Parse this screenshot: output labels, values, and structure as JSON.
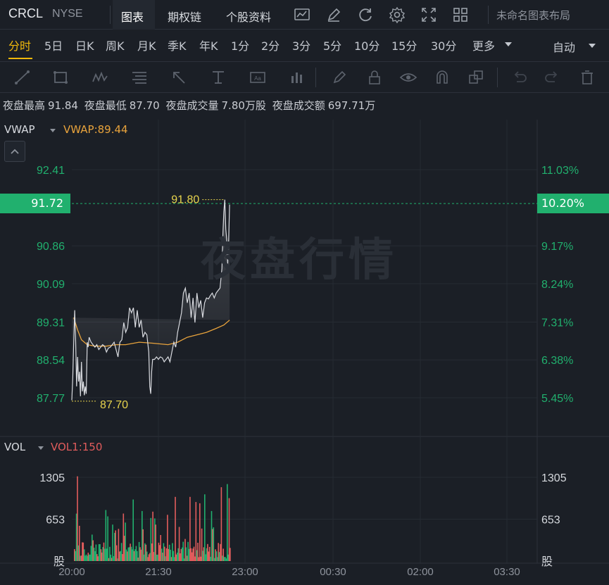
{
  "header": {
    "ticker": "CRCL",
    "exchange": "NYSE",
    "tabs": [
      "图表",
      "期权链",
      "个股资料"
    ],
    "active_tab": "图表",
    "layout_name": "未命名图表布局"
  },
  "periods": {
    "items": [
      "分时",
      "5日",
      "日K",
      "周K",
      "月K",
      "季K",
      "年K",
      "1分",
      "2分",
      "3分",
      "5分",
      "10分",
      "15分",
      "30分",
      "更多"
    ],
    "active": "分时",
    "scale_mode": "自动"
  },
  "stats": {
    "high_label": "夜盘最高",
    "high_value": "91.84",
    "low_label": "夜盘最低",
    "low_value": "87.70",
    "vol_label": "夜盘成交量",
    "vol_value": "7.80万股",
    "amt_label": "夜盘成交额",
    "amt_value": "697.71万"
  },
  "price_panel": {
    "indicator": "VWAP",
    "indicator_value": "VWAP:89.44",
    "watermark": "夜盘行情",
    "current_price": "91.72",
    "current_pct": "10.20%",
    "high_marker": "91.80",
    "low_marker": "87.70",
    "left_ticks": [
      "92.41",
      "91.72",
      "90.86",
      "90.09",
      "89.31",
      "88.54",
      "87.77"
    ],
    "right_ticks": [
      "11.03%",
      "10.20%",
      "9.17%",
      "8.24%",
      "7.31%",
      "6.38%",
      "5.45%"
    ]
  },
  "volume_panel": {
    "indicator": "VOL",
    "indicator_value": "VOL1:150",
    "left_ticks": [
      "1305",
      "653",
      "股"
    ],
    "right_ticks": [
      "1305",
      "653",
      "股"
    ]
  },
  "time_axis": [
    "20:00",
    "21:30",
    "23:00",
    "00:30",
    "02:00",
    "03:30"
  ],
  "colors": {
    "up": "#21b06e",
    "down": "#e15c5c",
    "price_line": "#d9dbe0",
    "vwap_line": "#e8a33c",
    "marker": "#e8d44d",
    "accent": "#f0b90b"
  },
  "chart_data": {
    "type": "line",
    "x_unit": "minutes since 20:00",
    "price_axis": {
      "min": 87.77,
      "max": 92.41
    },
    "price": [
      [
        0,
        87.72
      ],
      [
        1,
        88.2
      ],
      [
        2,
        88.9
      ],
      [
        3,
        89.55
      ],
      [
        4,
        88.9
      ],
      [
        5,
        88.0
      ],
      [
        6,
        88.6
      ],
      [
        7,
        88.1
      ],
      [
        8,
        88.3
      ],
      [
        9,
        87.8
      ],
      [
        10,
        88.5
      ],
      [
        11,
        87.9
      ],
      [
        12,
        88.1
      ],
      [
        13,
        87.82
      ],
      [
        14,
        88.0
      ],
      [
        15,
        87.85
      ],
      [
        16,
        88.9
      ],
      [
        17,
        88.8
      ],
      [
        18,
        89.0
      ],
      [
        20,
        88.9
      ],
      [
        22,
        88.85
      ],
      [
        24,
        88.8
      ],
      [
        26,
        88.85
      ],
      [
        28,
        88.75
      ],
      [
        30,
        88.8
      ],
      [
        32,
        88.85
      ],
      [
        34,
        88.82
      ],
      [
        36,
        88.7
      ],
      [
        38,
        88.78
      ],
      [
        40,
        88.8
      ],
      [
        42,
        88.85
      ],
      [
        44,
        88.9
      ],
      [
        46,
        88.75
      ],
      [
        48,
        88.6
      ],
      [
        50,
        88.9
      ],
      [
        52,
        88.95
      ],
      [
        54,
        89.3
      ],
      [
        56,
        89.1
      ],
      [
        58,
        89.2
      ],
      [
        60,
        89.6
      ],
      [
        62,
        89.5
      ],
      [
        64,
        89.6
      ],
      [
        66,
        89.2
      ],
      [
        68,
        89.55
      ],
      [
        70,
        89.2
      ],
      [
        72,
        89.35
      ],
      [
        74,
        89.0
      ],
      [
        76,
        89.1
      ],
      [
        78,
        89.05
      ],
      [
        80,
        88.7
      ],
      [
        81,
        88.0
      ],
      [
        82,
        87.85
      ],
      [
        83,
        88.3
      ],
      [
        84,
        88.55
      ],
      [
        86,
        88.55
      ],
      [
        88,
        88.6
      ],
      [
        90,
        88.55
      ],
      [
        92,
        88.6
      ],
      [
        94,
        88.58
      ],
      [
        96,
        88.5
      ],
      [
        98,
        88.55
      ],
      [
        100,
        88.6
      ],
      [
        102,
        88.5
      ],
      [
        104,
        88.7
      ],
      [
        106,
        88.9
      ],
      [
        108,
        88.8
      ],
      [
        110,
        89.1
      ],
      [
        112,
        89.3
      ],
      [
        114,
        89.5
      ],
      [
        116,
        89.9
      ],
      [
        118,
        90.0
      ],
      [
        120,
        89.7
      ],
      [
        122,
        89.9
      ],
      [
        124,
        89.4
      ],
      [
        126,
        89.8
      ],
      [
        128,
        89.3
      ],
      [
        130,
        89.9
      ],
      [
        132,
        89.6
      ],
      [
        134,
        89.75
      ],
      [
        136,
        89.4
      ],
      [
        138,
        89.7
      ],
      [
        140,
        89.8
      ],
      [
        142,
        89.78
      ],
      [
        144,
        89.85
      ],
      [
        146,
        89.9
      ],
      [
        148,
        89.8
      ],
      [
        150,
        89.9
      ],
      [
        152,
        89.95
      ],
      [
        154,
        90.0
      ],
      [
        156,
        90.4
      ],
      [
        157,
        91.1
      ],
      [
        158,
        91.55
      ],
      [
        159,
        91.8
      ],
      [
        160,
        91.2
      ],
      [
        161,
        91.0
      ],
      [
        162,
        90.5
      ],
      [
        163,
        91.0
      ],
      [
        164,
        91.7
      ]
    ],
    "vwap": [
      [
        2,
        89.4
      ],
      [
        6,
        89.15
      ],
      [
        10,
        88.95
      ],
      [
        16,
        88.85
      ],
      [
        24,
        88.82
      ],
      [
        36,
        88.82
      ],
      [
        46,
        88.85
      ],
      [
        56,
        88.85
      ],
      [
        70,
        88.9
      ],
      [
        84,
        88.88
      ],
      [
        100,
        88.85
      ],
      [
        110,
        88.9
      ],
      [
        120,
        89.0
      ],
      [
        130,
        89.05
      ],
      [
        140,
        89.1
      ],
      [
        150,
        89.18
      ],
      [
        158,
        89.25
      ],
      [
        164,
        89.35
      ]
    ],
    "high": 91.8,
    "low": 87.7,
    "last": 91.72,
    "vwap_last": 89.44,
    "volume_axis": {
      "min": 0,
      "max": 1305
    },
    "volume_count": 160
  }
}
